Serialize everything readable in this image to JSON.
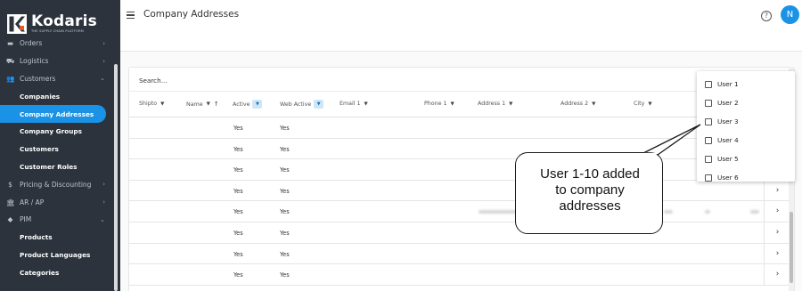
{
  "app": {
    "brand": "Kodaris",
    "tagline": "THE SUPPLY CHAIN PLATFORM",
    "accent_color": "#1a92e6"
  },
  "sidebar": {
    "items": [
      {
        "label": "Orders",
        "icon": "cart-icon",
        "chevron": "›"
      },
      {
        "label": "Logistics",
        "icon": "truck-icon",
        "chevron": "›"
      },
      {
        "label": "Customers",
        "icon": "users-icon",
        "chevron": "⌄"
      },
      {
        "label": "Companies"
      },
      {
        "label": "Company Addresses",
        "active": true
      },
      {
        "label": "Company Groups"
      },
      {
        "label": "Customers"
      },
      {
        "label": "Customer Roles"
      },
      {
        "label": "Pricing & Discounting",
        "icon": "dollar-icon",
        "chevron": "›"
      },
      {
        "label": "AR / AP",
        "icon": "bank-icon",
        "chevron": "›"
      },
      {
        "label": "PIM",
        "icon": "tag-icon",
        "chevron": "⌄"
      },
      {
        "label": "Products"
      },
      {
        "label": "Product Languages"
      },
      {
        "label": "Categories"
      }
    ]
  },
  "header": {
    "title": "Company Addresses",
    "help_icon": "?",
    "avatar_initial": "N"
  },
  "table": {
    "search_placeholder": "Search...",
    "columns": [
      {
        "label": "Shipto",
        "caret": "▼"
      },
      {
        "label": "Name",
        "caret": "▼",
        "sort": "↑"
      },
      {
        "label": "Active",
        "filter": "▼"
      },
      {
        "label": "Web Active",
        "filter": "▼"
      },
      {
        "label": "Email 1",
        "caret": "▼"
      },
      {
        "label": "Phone 1",
        "caret": "▼"
      },
      {
        "label": "Address 1",
        "caret": "▼"
      },
      {
        "label": "Address 2",
        "caret": "▼"
      },
      {
        "label": "City",
        "caret": "▼"
      }
    ],
    "rows": [
      {
        "active": "Yes",
        "web_active": "Yes"
      },
      {
        "active": "Yes",
        "web_active": "Yes"
      },
      {
        "active": "Yes",
        "web_active": "Yes"
      },
      {
        "active": "Yes",
        "web_active": "Yes"
      },
      {
        "active": "Yes",
        "web_active": "Yes"
      },
      {
        "active": "Yes",
        "web_active": "Yes"
      },
      {
        "active": "Yes",
        "web_active": "Yes"
      },
      {
        "active": "Yes",
        "web_active": "Yes"
      }
    ],
    "row_arrow": "›"
  },
  "column_chooser": {
    "options": [
      "User 1",
      "User 2",
      "User 3",
      "User 4",
      "User 5",
      "User 6"
    ]
  },
  "callout": {
    "text": "User 1-10 added\nto company\naddresses"
  }
}
